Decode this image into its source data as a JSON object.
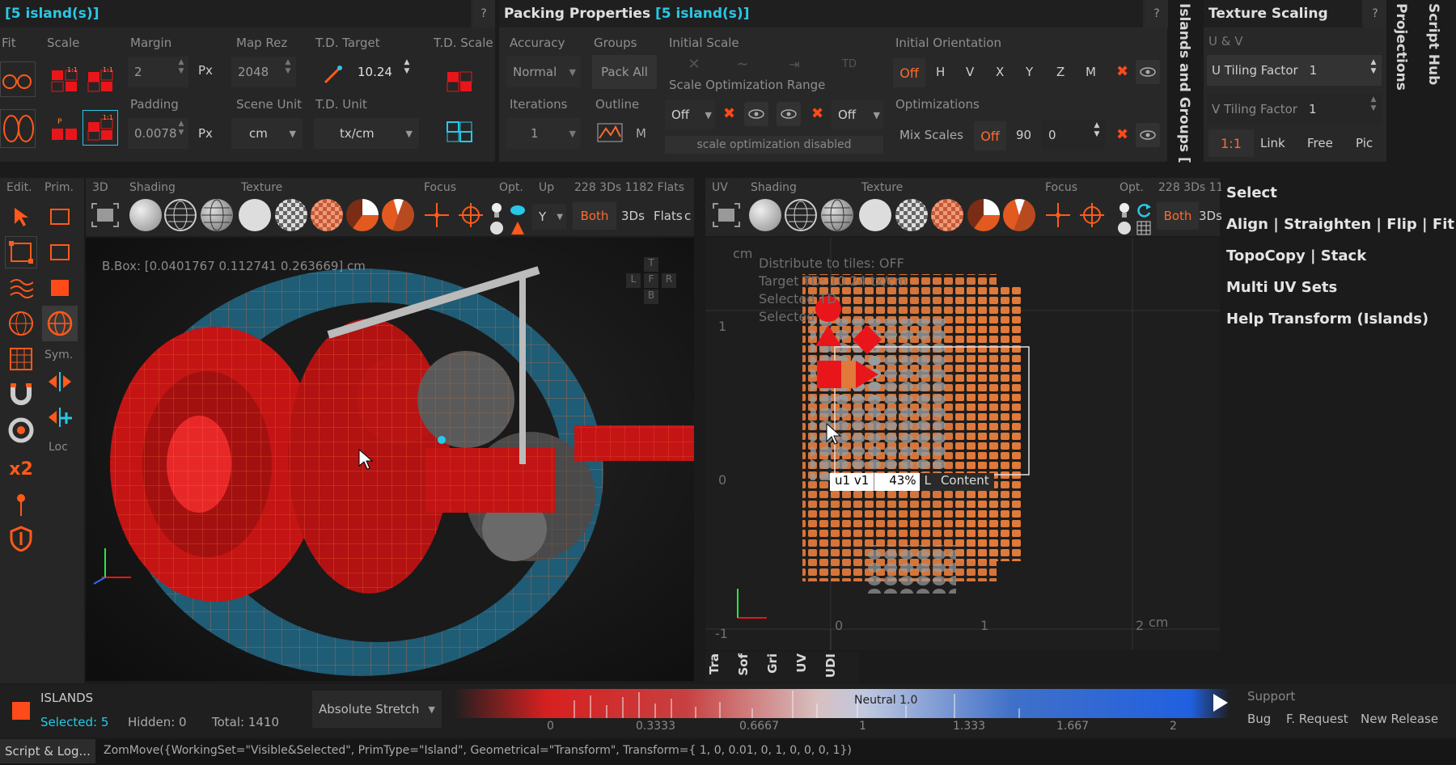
{
  "packing_left": {
    "title": "[5 island(s)]",
    "help": "?",
    "labels": {
      "fit": "Fit",
      "scale": "Scale",
      "margin": "Margin",
      "map_rez": "Map Rez",
      "td_target": "T.D. Target",
      "td_scale": "T.D. Scale",
      "padding": "Padding",
      "scene_unit": "Scene Unit",
      "td_unit": "T.D. Unit"
    },
    "margin_value": "2",
    "margin_unit": "Px",
    "map_rez_value": "2048",
    "td_target_value": "10.24",
    "padding_value": "0.0078",
    "padding_unit": "Px",
    "scene_unit_value": "cm",
    "td_unit_value": "tx/cm"
  },
  "packing_props": {
    "title_prefix": "Packing Properties ",
    "title_suffix": "[5 island(s)]",
    "help": "?",
    "labels": {
      "accuracy": "Accuracy",
      "groups": "Groups",
      "initial_scale": "Initial Scale",
      "initial_orientation": "Initial Orientation",
      "scale_opt_range": "Scale Optimization Range",
      "iterations": "Iterations",
      "outline": "Outline",
      "optimizations": "Optimizations"
    },
    "accuracy_value": "Normal",
    "pack_all": "Pack All",
    "td_short": "TD",
    "orientation_off": "Off",
    "orientation_axes": [
      "H",
      "V",
      "X",
      "Y",
      "Z",
      "M"
    ],
    "iterations_value": "1",
    "outline_m": "M",
    "range_off_1": "Off",
    "range_off_2": "Off",
    "scale_opt_disabled": "scale optimization disabled",
    "mix_scales": "Mix Scales",
    "mix_off": "Off",
    "mix_angle": "90",
    "mix_zero": "0"
  },
  "side_tabs": {
    "islands_groups": "Islands and Groups [",
    "projections": "Projections",
    "script_hub": "Script Hub"
  },
  "texture_scaling": {
    "title": "Texture Scaling",
    "help": "?",
    "uv_label": "U & V",
    "u_label": "U Tiling Factor",
    "u_value": "1",
    "v_label": "V Tiling Factor",
    "v_value": "1",
    "ratio": "1:1",
    "link": "Link",
    "free": "Free",
    "pic": "Pic"
  },
  "left_tools": {
    "edit": "Edit.",
    "prim": "Prim.",
    "sym": "Sym.",
    "loc": "Loc",
    "x2": "x2"
  },
  "vp3d": {
    "labels": {
      "mode": "3D",
      "shading": "Shading",
      "texture": "Texture",
      "focus": "Focus",
      "opt": "Opt.",
      "up": "Up",
      "stats": "228 3Ds 1182 Flats"
    },
    "up_value": "Y",
    "both": "Both",
    "threeds": "3Ds",
    "flats": "Flats",
    "c": "c",
    "bbox": "B.Box: [0.0401767 0.112741 0.263669] cm",
    "view_t": "T",
    "view_l": "L",
    "view_f": "F",
    "view_r": "R",
    "view_b": "B"
  },
  "uvview": {
    "labels": {
      "mode": "UV",
      "shading": "Shading",
      "texture": "Texture",
      "focus": "Focus",
      "opt": "Opt.",
      "stats": "228 3Ds 11"
    },
    "both": "Both",
    "threeds": "3Ds",
    "unit_top": "cm",
    "unit_bottom": "cm",
    "axis_y1": "1",
    "axis_y0": "0",
    "axis_yn1": "-1",
    "axis_x0": "0",
    "axis_x1": "1",
    "axis_x2": "2",
    "info1": "Distribute to tiles: OFF",
    "info2": "Target TD: 10.24 tx/cm",
    "info3": "Selected TD",
    "info4": "Selected",
    "tile_tip_uv": "u1 v1",
    "tile_tip_pct": "43%",
    "tile_tip_l": "L",
    "tile_tip_content": "Content",
    "bottom_tabs": [
      "Tra",
      "Sof",
      "Gri",
      "UV",
      "UDI"
    ]
  },
  "right_menu": {
    "items": [
      "Select",
      "Align | Straighten | Flip | Fit",
      "TopoCopy | Stack",
      "Multi UV Sets",
      "Help Transform (Islands)"
    ]
  },
  "status": {
    "islands": "ISLANDS",
    "selected": "Selected: 5",
    "hidden": "Hidden: 0",
    "total": "Total: 1410",
    "stretch_mode": "Absolute Stretch",
    "neutral": "Neutral 1.0",
    "ticks": [
      "0",
      "0.3333",
      "0.6667",
      "1",
      "1.333",
      "1.667",
      "2"
    ],
    "support": "Support",
    "links": [
      "Bug",
      "F. Request",
      "New Release"
    ]
  },
  "log": {
    "button": "Script & Log...",
    "text": "ZomMove({WorkingSet=\"Visible&Selected\", PrimType=\"Island\", Geometrical=\"Transform\", Transform={ 1, 0, 0.01, 0, 1, 0, 0, 0, 1})"
  },
  "colors": {
    "accent_orange": "#ff6a2e",
    "accent_cyan": "#28c8e6",
    "selection_red": "#e8161a",
    "uv_orange": "#e0793a"
  }
}
